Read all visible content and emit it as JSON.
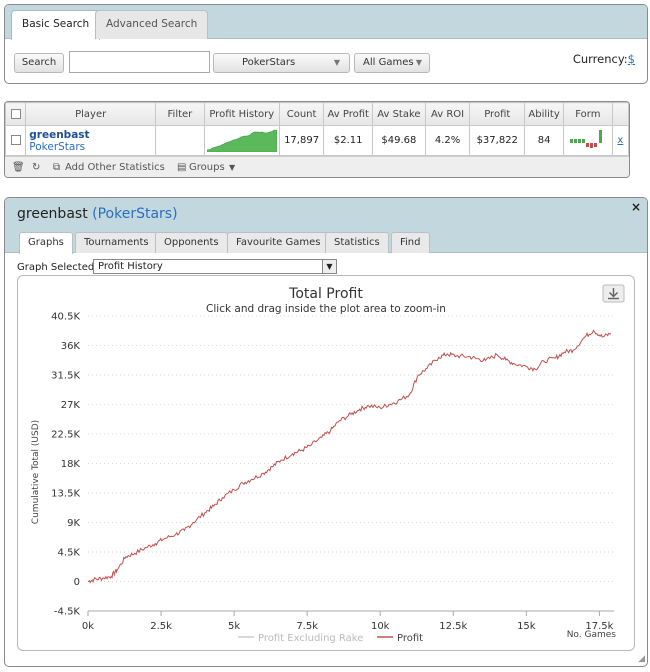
{
  "search": {
    "tabs": [
      "Basic Search",
      "Advanced Search"
    ],
    "search_button": "Search",
    "query": "",
    "site_select": "PokerStars",
    "games_select": "All Games",
    "currency_label": "Currency:",
    "currency_value": "$"
  },
  "player_table": {
    "headers": [
      "Player",
      "Filter",
      "Profit History",
      "Count",
      "Av Profit",
      "Av Stake",
      "Av ROI",
      "Profit",
      "Ability",
      "Form"
    ],
    "row": {
      "name": "greenbast",
      "site": "PokerStars",
      "count": "17,897",
      "av_profit": "$2.11",
      "av_stake": "$49.68",
      "av_roi": "4.2%",
      "profit": "$37,822",
      "ability": "84",
      "remove": "x"
    },
    "tools": {
      "add_stats": "Add Other Statistics",
      "groups": "Groups"
    }
  },
  "detail": {
    "player": "greenbast",
    "site_open": "(",
    "site": "PokerStars",
    "site_close": ")",
    "close": "×",
    "tabs": [
      "Graphs",
      "Tournaments",
      "Opponents",
      "Favourite Games",
      "Statistics",
      "Find"
    ],
    "graph_selected_label": "Graph Selected:",
    "graph_selected": "Profit History"
  },
  "colors": {
    "profit": "#c0504d",
    "rake": "#cccccc",
    "spark": "#5bb85b"
  },
  "chart_data": {
    "type": "line",
    "title": "Total Profit",
    "subtitle": "Click and drag inside the plot area to zoom-in",
    "ylabel": "Cumulative Total (USD)",
    "xlabel": "No. Games",
    "x_ticks": [
      "0k",
      "2.5k",
      "5k",
      "7.5k",
      "10k",
      "12.5k",
      "15k",
      "17.5k"
    ],
    "y_ticks": [
      "-4.5K",
      "0",
      "4.5K",
      "9K",
      "13.5K",
      "18K",
      "22.5K",
      "27K",
      "31.5K",
      "36K",
      "40.5K"
    ],
    "xlim": [
      0,
      18000
    ],
    "ylim": [
      -4500,
      40500
    ],
    "legend": [
      "Profit Excluding Rake",
      "Profit"
    ],
    "series": [
      {
        "name": "Profit",
        "x": [
          0,
          200,
          500,
          800,
          1000,
          1300,
          1600,
          2000,
          2300,
          2600,
          3000,
          3300,
          3600,
          4000,
          4300,
          4600,
          5000,
          5300,
          5600,
          6000,
          6300,
          6600,
          7000,
          7300,
          7600,
          8000,
          8300,
          8600,
          9000,
          9300,
          9600,
          10000,
          10300,
          10600,
          11000,
          11300,
          11600,
          12000,
          12300,
          12600,
          13000,
          13300,
          13600,
          14000,
          14300,
          14600,
          15000,
          15300,
          15600,
          16000,
          16300,
          16600,
          17000,
          17300,
          17600,
          17897
        ],
        "y": [
          0,
          300,
          500,
          800,
          1800,
          3800,
          4300,
          5200,
          5800,
          6500,
          7200,
          7800,
          9000,
          10500,
          11500,
          12800,
          14000,
          15000,
          15600,
          16500,
          17500,
          18500,
          19500,
          20000,
          20700,
          22000,
          23000,
          24500,
          25500,
          26300,
          26800,
          26500,
          27000,
          27500,
          28500,
          31500,
          32500,
          34200,
          34700,
          34400,
          34300,
          34000,
          33700,
          34600,
          33800,
          33200,
          32800,
          32400,
          33600,
          34100,
          35000,
          35300,
          37300,
          38300,
          37300,
          37822
        ]
      }
    ]
  }
}
